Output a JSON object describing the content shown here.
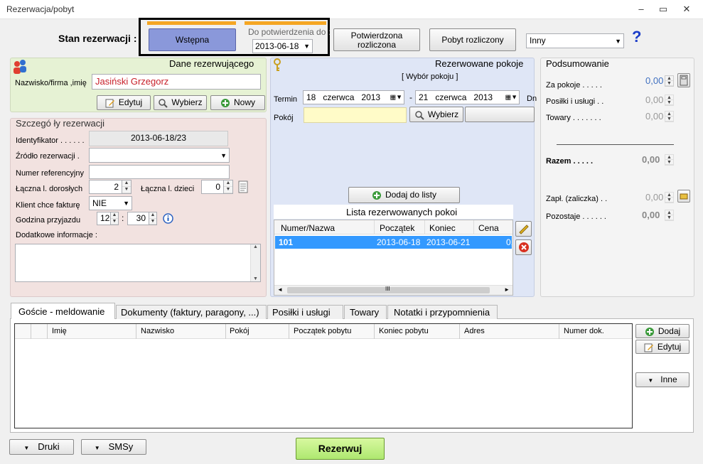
{
  "window": {
    "title": "Rezerwacja/pobyt",
    "minimize": "–",
    "maximize": "▭",
    "close": "✕"
  },
  "status": {
    "label": "Stan rezerwacji :",
    "initial": "Wstępna",
    "confirm_until_label": "Do potwierdzenia do :",
    "confirm_until_date": "2013-06-18",
    "confirmed_settled": "Potwierdzona rozliczona",
    "stay_settled": "Pobyt rozliczony",
    "other_select": "Inny",
    "help": "?",
    "colors": {
      "selected": "#8090d8",
      "accent": "#f5a623"
    }
  },
  "guest_panel": {
    "title": "Dane rezerwującego",
    "name_label": "Nazwisko/firma ,imię",
    "name_value": "Jasiński Grzegorz",
    "edit_btn": "Edytuj",
    "choose_btn": "Wybierz",
    "new_btn": "Nowy",
    "bg": "#e6f2d4"
  },
  "details": {
    "title": "Szczegó ły rezerwacji",
    "id_label": "Identyfikator . . . . . .",
    "id_value": "2013-06-18/23",
    "source_label": "Źródło rezerwacji .",
    "source_value": "",
    "ref_label": "Numer referencyjny",
    "ref_value": "",
    "adults_label": "Łączna l. dorosłych",
    "adults_value": "2",
    "children_label": "Łączna l. dzieci",
    "children_value": "0",
    "invoice_label": "Klient chce fakturę",
    "invoice_value": "NIE",
    "arrival_label": "Godzina przyjazdu",
    "arrival_hour": "12",
    "arrival_sep": ":",
    "arrival_min": "30",
    "notes_label": "Dodatkowe informacje :",
    "bg": "#f2e2e0"
  },
  "rooms": {
    "title": "Rezerwowane pokoje",
    "choose_room": "[ Wybór pokoju ]",
    "term_label": "Termin",
    "from_day": "18",
    "from_month": "czerwca",
    "from_year": "2013",
    "dash": "-",
    "to_day": "21",
    "to_month": "czerwca",
    "to_year": "2013",
    "dn_label": "Dn",
    "room_label": "Pokój",
    "room_value": "",
    "choose_btn": "Wybierz",
    "add_btn": "Dodaj do listy",
    "list_title": "Lista rezerwowanych pokoi",
    "columns": [
      "Numer/Nazwa",
      "Początek",
      "Koniec",
      "Cena"
    ],
    "rows": [
      {
        "number": "101",
        "start": "2013-06-18",
        "end": "2013-06-21",
        "price": "0,"
      }
    ],
    "bg": "#dfe6f6"
  },
  "summary": {
    "title": "Podsumowanie",
    "rooms_label": "Za pokoje . . . . .",
    "rooms_value": "0,00",
    "meals_label": "Posiłki i usługi . .",
    "meals_value": "0,00",
    "goods_label": "Towary . . . . . . .",
    "goods_value": "0,00",
    "total_label": "Razem . . . . .",
    "total_value": "0,00",
    "paid_label": "Zapł. (zaliczka) . .",
    "paid_value": "0,00",
    "remaining_label": "Pozostaje . . . . . .",
    "remaining_value": "0,00"
  },
  "tabs": [
    {
      "label": "Goście - meldowanie"
    },
    {
      "label": "Dokumenty (faktury, paragony, ...)"
    },
    {
      "label": "Posiłki i usługi"
    },
    {
      "label": "Towary"
    },
    {
      "label": "Notatki i przypomnienia"
    }
  ],
  "guests_table": {
    "columns": [
      "",
      "Imię",
      "Nazwisko",
      "Pokój",
      "Początek pobytu",
      "Koniec pobytu",
      "Adres",
      "Numer dok."
    ]
  },
  "guests_buttons": {
    "add": "Dodaj",
    "edit": "Edytuj",
    "other": "Inne"
  },
  "bottom": {
    "prints": "Druki",
    "sms": "SMSy",
    "reserve": "Rezerwuj"
  }
}
